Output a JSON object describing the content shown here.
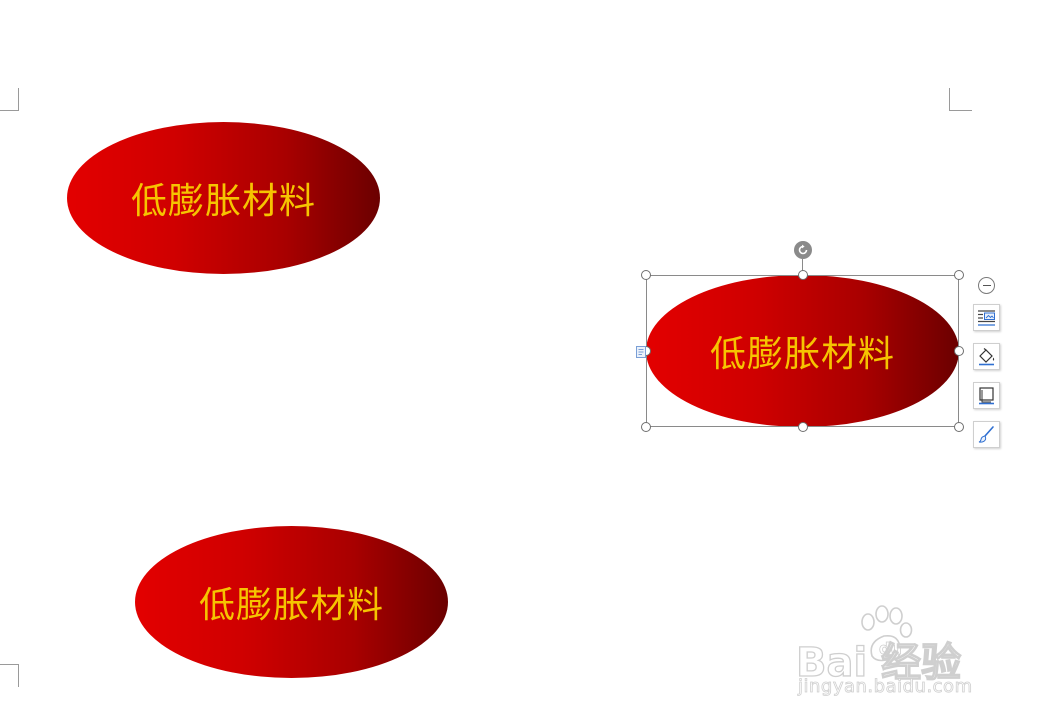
{
  "document": {
    "shapes": [
      {
        "text": "低膨胀材料"
      },
      {
        "text": "低膨胀材料"
      },
      {
        "text": "低膨胀材料"
      }
    ],
    "selected_shape": 2
  },
  "quick_toolbar": {
    "items": [
      {
        "icon": "collapse-icon"
      },
      {
        "icon": "layout-options-icon"
      },
      {
        "icon": "shape-fill-icon"
      },
      {
        "icon": "shape-outline-icon"
      },
      {
        "icon": "format-brush-icon"
      }
    ]
  },
  "watermark": {
    "brand": "Bai  经验",
    "url": "jingyan.baidu.com"
  },
  "colors": {
    "shape_gradient_start": "#e30000",
    "shape_gradient_end": "#6b0000",
    "shape_text": "#f6c400",
    "selection_frame": "#8a8a8a",
    "tool_icon_accent": "#2f6fd1"
  }
}
